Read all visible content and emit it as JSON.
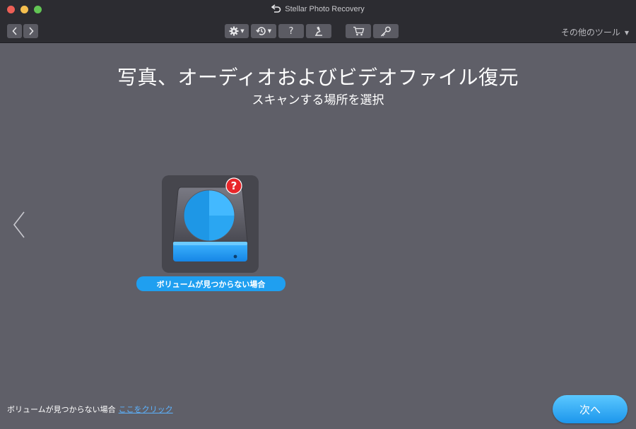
{
  "window": {
    "title": "Stellar Photo Recovery"
  },
  "toolbar": {
    "other_tools_label": "その他のツール",
    "icons": [
      "back-icon",
      "forward-icon",
      "gear-icon",
      "history-icon",
      "help-icon",
      "scan-icon",
      "cart-icon",
      "key-icon"
    ]
  },
  "main": {
    "heading": "写真、オーディオおよびビデオファイル復元",
    "subheading": "スキャンする場所を選択",
    "drive_label": "ボリュームが見つからない場合",
    "badge_glyph": "?"
  },
  "footer": {
    "text": "ボリュームが見つからない場合",
    "link": "ここをクリック",
    "next_label": "次へ"
  },
  "colors": {
    "background": "#5f5f68",
    "toolbar": "#2c2c31",
    "accent": "#1f9ff0",
    "link": "#5cb3ff",
    "badge": "#e8262a"
  }
}
